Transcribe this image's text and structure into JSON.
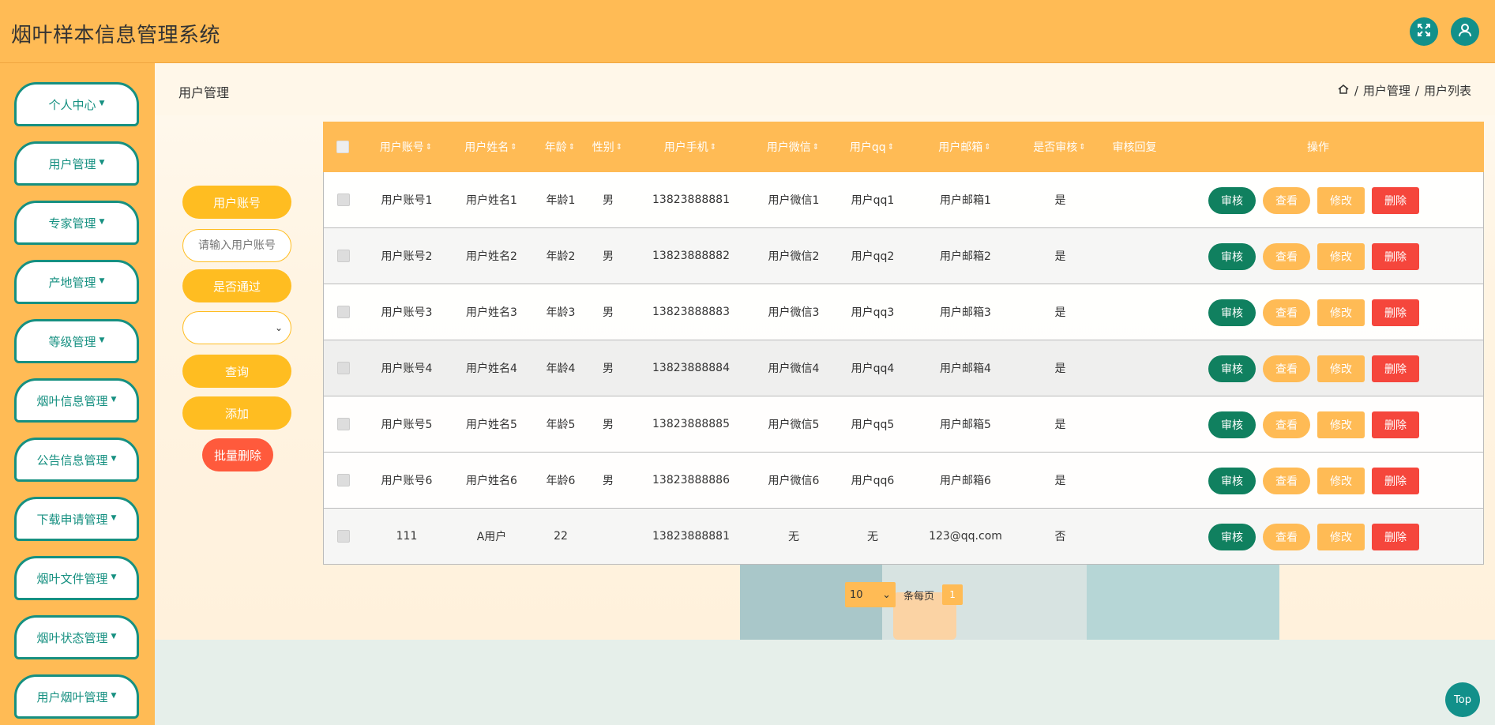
{
  "app": {
    "title": "烟叶样本信息管理系统"
  },
  "header": {
    "fullscreen_icon": "expand-icon",
    "user_icon": "user-icon",
    "accent": "#12908a",
    "bg": "#ffbb55"
  },
  "sidebar": {
    "items": [
      {
        "label": "个人中心"
      },
      {
        "label": "用户管理"
      },
      {
        "label": "专家管理"
      },
      {
        "label": "产地管理"
      },
      {
        "label": "等级管理"
      },
      {
        "label": "烟叶信息管理"
      },
      {
        "label": "公告信息管理"
      },
      {
        "label": "下载申请管理"
      },
      {
        "label": "烟叶文件管理"
      },
      {
        "label": "烟叶状态管理"
      },
      {
        "label": "用户烟叶管理"
      }
    ]
  },
  "page": {
    "title": "用户管理",
    "breadcrumb": [
      "用户管理",
      "用户列表"
    ],
    "breadcrumb_sep": "/"
  },
  "filter": {
    "account_label": "用户账号",
    "account_placeholder": "请输入用户账号",
    "passed_label": "是否通过",
    "passed_selected": "",
    "search_label": "查询",
    "add_label": "添加",
    "batch_delete_label": "批量删除"
  },
  "table": {
    "columns": [
      "用户账号",
      "用户姓名",
      "年龄",
      "性别",
      "用户手机",
      "用户微信",
      "用户qq",
      "用户邮箱",
      "是否审核",
      "审核回复",
      "操作"
    ],
    "sortable": [
      true,
      true,
      true,
      true,
      true,
      true,
      true,
      true,
      true,
      false,
      false
    ],
    "rows": [
      {
        "account": "用户账号1",
        "name": "用户姓名1",
        "age": "年龄1",
        "gender": "男",
        "phone": "13823888881",
        "wechat": "用户微信1",
        "qq": "用户qq1",
        "email": "用户邮箱1",
        "audited": "是",
        "reply": ""
      },
      {
        "account": "用户账号2",
        "name": "用户姓名2",
        "age": "年龄2",
        "gender": "男",
        "phone": "13823888882",
        "wechat": "用户微信2",
        "qq": "用户qq2",
        "email": "用户邮箱2",
        "audited": "是",
        "reply": ""
      },
      {
        "account": "用户账号3",
        "name": "用户姓名3",
        "age": "年龄3",
        "gender": "男",
        "phone": "13823888883",
        "wechat": "用户微信3",
        "qq": "用户qq3",
        "email": "用户邮箱3",
        "audited": "是",
        "reply": ""
      },
      {
        "account": "用户账号4",
        "name": "用户姓名4",
        "age": "年龄4",
        "gender": "男",
        "phone": "13823888884",
        "wechat": "用户微信4",
        "qq": "用户qq4",
        "email": "用户邮箱4",
        "audited": "是",
        "reply": ""
      },
      {
        "account": "用户账号5",
        "name": "用户姓名5",
        "age": "年龄5",
        "gender": "男",
        "phone": "13823888885",
        "wechat": "用户微信5",
        "qq": "用户qq5",
        "email": "用户邮箱5",
        "audited": "是",
        "reply": ""
      },
      {
        "account": "用户账号6",
        "name": "用户姓名6",
        "age": "年龄6",
        "gender": "男",
        "phone": "13823888886",
        "wechat": "用户微信6",
        "qq": "用户qq6",
        "email": "用户邮箱6",
        "audited": "是",
        "reply": ""
      },
      {
        "account": "111",
        "name": "A用户",
        "age": "22",
        "gender": "",
        "phone": "13823888881",
        "wechat": "无",
        "qq": "无",
        "email": "123@qq.com",
        "audited": "否",
        "reply": ""
      }
    ],
    "actions": {
      "audit": "审核",
      "view": "查看",
      "edit": "修改",
      "delete": "删除"
    }
  },
  "pagination": {
    "page_size": "10",
    "per_page_label": "条每页",
    "current_page": "1"
  },
  "back_to_top": "Top",
  "colors": {
    "primary": "#ffbb55",
    "yellow_btn": "#ffbd21",
    "teal": "#169081",
    "green_btn": "#10805f",
    "red_btn": "#f5463c"
  }
}
